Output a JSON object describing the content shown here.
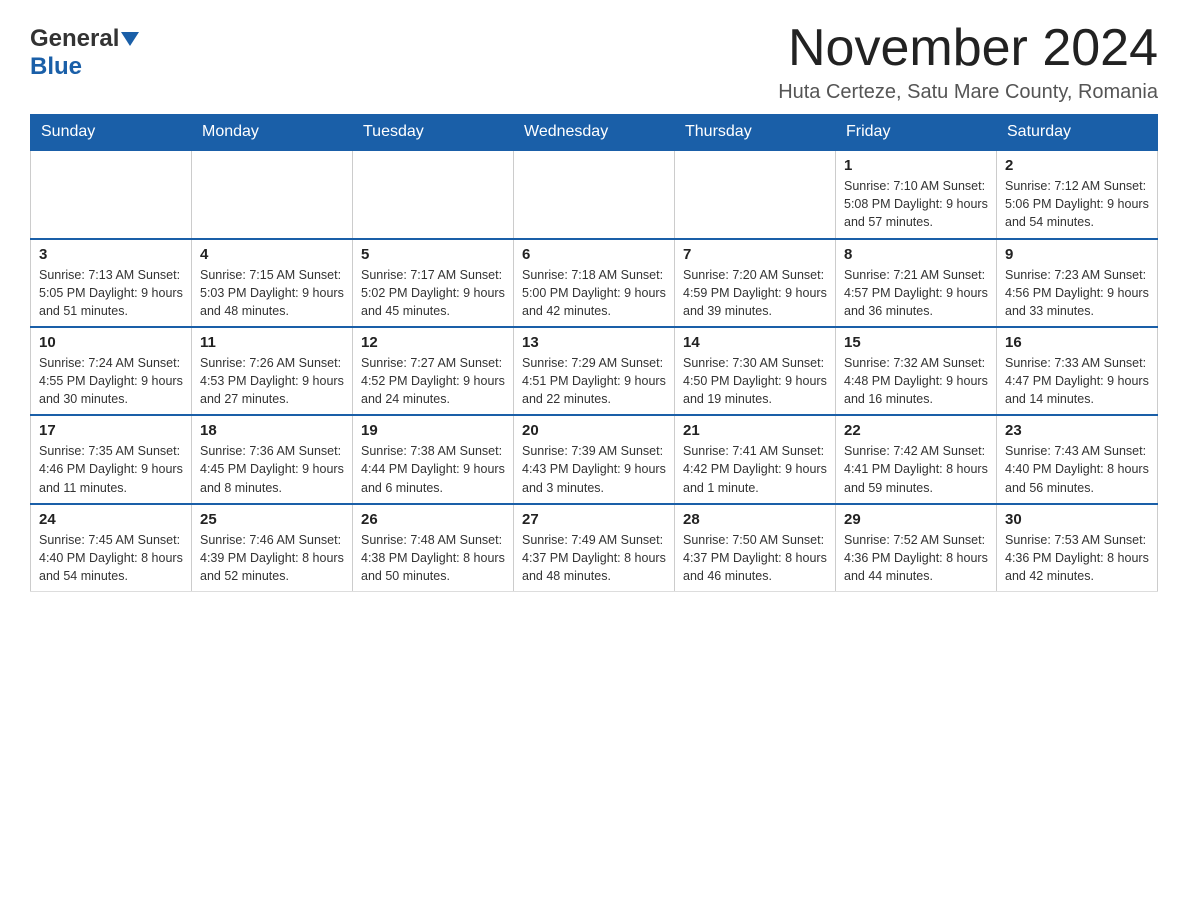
{
  "header": {
    "logo_general": "General",
    "logo_blue": "Blue",
    "month_title": "November 2024",
    "location": "Huta Certeze, Satu Mare County, Romania"
  },
  "days_of_week": [
    "Sunday",
    "Monday",
    "Tuesday",
    "Wednesday",
    "Thursday",
    "Friday",
    "Saturday"
  ],
  "weeks": [
    [
      {
        "day": "",
        "info": ""
      },
      {
        "day": "",
        "info": ""
      },
      {
        "day": "",
        "info": ""
      },
      {
        "day": "",
        "info": ""
      },
      {
        "day": "",
        "info": ""
      },
      {
        "day": "1",
        "info": "Sunrise: 7:10 AM\nSunset: 5:08 PM\nDaylight: 9 hours\nand 57 minutes."
      },
      {
        "day": "2",
        "info": "Sunrise: 7:12 AM\nSunset: 5:06 PM\nDaylight: 9 hours\nand 54 minutes."
      }
    ],
    [
      {
        "day": "3",
        "info": "Sunrise: 7:13 AM\nSunset: 5:05 PM\nDaylight: 9 hours\nand 51 minutes."
      },
      {
        "day": "4",
        "info": "Sunrise: 7:15 AM\nSunset: 5:03 PM\nDaylight: 9 hours\nand 48 minutes."
      },
      {
        "day": "5",
        "info": "Sunrise: 7:17 AM\nSunset: 5:02 PM\nDaylight: 9 hours\nand 45 minutes."
      },
      {
        "day": "6",
        "info": "Sunrise: 7:18 AM\nSunset: 5:00 PM\nDaylight: 9 hours\nand 42 minutes."
      },
      {
        "day": "7",
        "info": "Sunrise: 7:20 AM\nSunset: 4:59 PM\nDaylight: 9 hours\nand 39 minutes."
      },
      {
        "day": "8",
        "info": "Sunrise: 7:21 AM\nSunset: 4:57 PM\nDaylight: 9 hours\nand 36 minutes."
      },
      {
        "day": "9",
        "info": "Sunrise: 7:23 AM\nSunset: 4:56 PM\nDaylight: 9 hours\nand 33 minutes."
      }
    ],
    [
      {
        "day": "10",
        "info": "Sunrise: 7:24 AM\nSunset: 4:55 PM\nDaylight: 9 hours\nand 30 minutes."
      },
      {
        "day": "11",
        "info": "Sunrise: 7:26 AM\nSunset: 4:53 PM\nDaylight: 9 hours\nand 27 minutes."
      },
      {
        "day": "12",
        "info": "Sunrise: 7:27 AM\nSunset: 4:52 PM\nDaylight: 9 hours\nand 24 minutes."
      },
      {
        "day": "13",
        "info": "Sunrise: 7:29 AM\nSunset: 4:51 PM\nDaylight: 9 hours\nand 22 minutes."
      },
      {
        "day": "14",
        "info": "Sunrise: 7:30 AM\nSunset: 4:50 PM\nDaylight: 9 hours\nand 19 minutes."
      },
      {
        "day": "15",
        "info": "Sunrise: 7:32 AM\nSunset: 4:48 PM\nDaylight: 9 hours\nand 16 minutes."
      },
      {
        "day": "16",
        "info": "Sunrise: 7:33 AM\nSunset: 4:47 PM\nDaylight: 9 hours\nand 14 minutes."
      }
    ],
    [
      {
        "day": "17",
        "info": "Sunrise: 7:35 AM\nSunset: 4:46 PM\nDaylight: 9 hours\nand 11 minutes."
      },
      {
        "day": "18",
        "info": "Sunrise: 7:36 AM\nSunset: 4:45 PM\nDaylight: 9 hours\nand 8 minutes."
      },
      {
        "day": "19",
        "info": "Sunrise: 7:38 AM\nSunset: 4:44 PM\nDaylight: 9 hours\nand 6 minutes."
      },
      {
        "day": "20",
        "info": "Sunrise: 7:39 AM\nSunset: 4:43 PM\nDaylight: 9 hours\nand 3 minutes."
      },
      {
        "day": "21",
        "info": "Sunrise: 7:41 AM\nSunset: 4:42 PM\nDaylight: 9 hours\nand 1 minute."
      },
      {
        "day": "22",
        "info": "Sunrise: 7:42 AM\nSunset: 4:41 PM\nDaylight: 8 hours\nand 59 minutes."
      },
      {
        "day": "23",
        "info": "Sunrise: 7:43 AM\nSunset: 4:40 PM\nDaylight: 8 hours\nand 56 minutes."
      }
    ],
    [
      {
        "day": "24",
        "info": "Sunrise: 7:45 AM\nSunset: 4:40 PM\nDaylight: 8 hours\nand 54 minutes."
      },
      {
        "day": "25",
        "info": "Sunrise: 7:46 AM\nSunset: 4:39 PM\nDaylight: 8 hours\nand 52 minutes."
      },
      {
        "day": "26",
        "info": "Sunrise: 7:48 AM\nSunset: 4:38 PM\nDaylight: 8 hours\nand 50 minutes."
      },
      {
        "day": "27",
        "info": "Sunrise: 7:49 AM\nSunset: 4:37 PM\nDaylight: 8 hours\nand 48 minutes."
      },
      {
        "day": "28",
        "info": "Sunrise: 7:50 AM\nSunset: 4:37 PM\nDaylight: 8 hours\nand 46 minutes."
      },
      {
        "day": "29",
        "info": "Sunrise: 7:52 AM\nSunset: 4:36 PM\nDaylight: 8 hours\nand 44 minutes."
      },
      {
        "day": "30",
        "info": "Sunrise: 7:53 AM\nSunset: 4:36 PM\nDaylight: 8 hours\nand 42 minutes."
      }
    ]
  ]
}
